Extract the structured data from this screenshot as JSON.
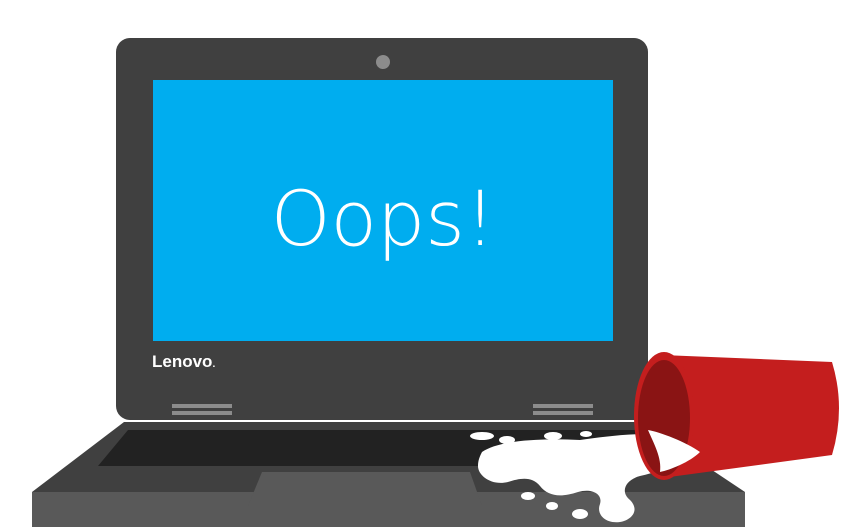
{
  "screen": {
    "message": "Oops!",
    "background_color": "#00adef"
  },
  "laptop": {
    "brand": "Lenovo",
    "brand_dot": ".",
    "body_color": "#404040",
    "keyboard_color": "#222222",
    "trackpad_color": "#595959"
  },
  "spill": {
    "cup_color": "#c41e1e",
    "cup_inner_color": "#8a1414",
    "liquid_color": "#ffffff"
  }
}
